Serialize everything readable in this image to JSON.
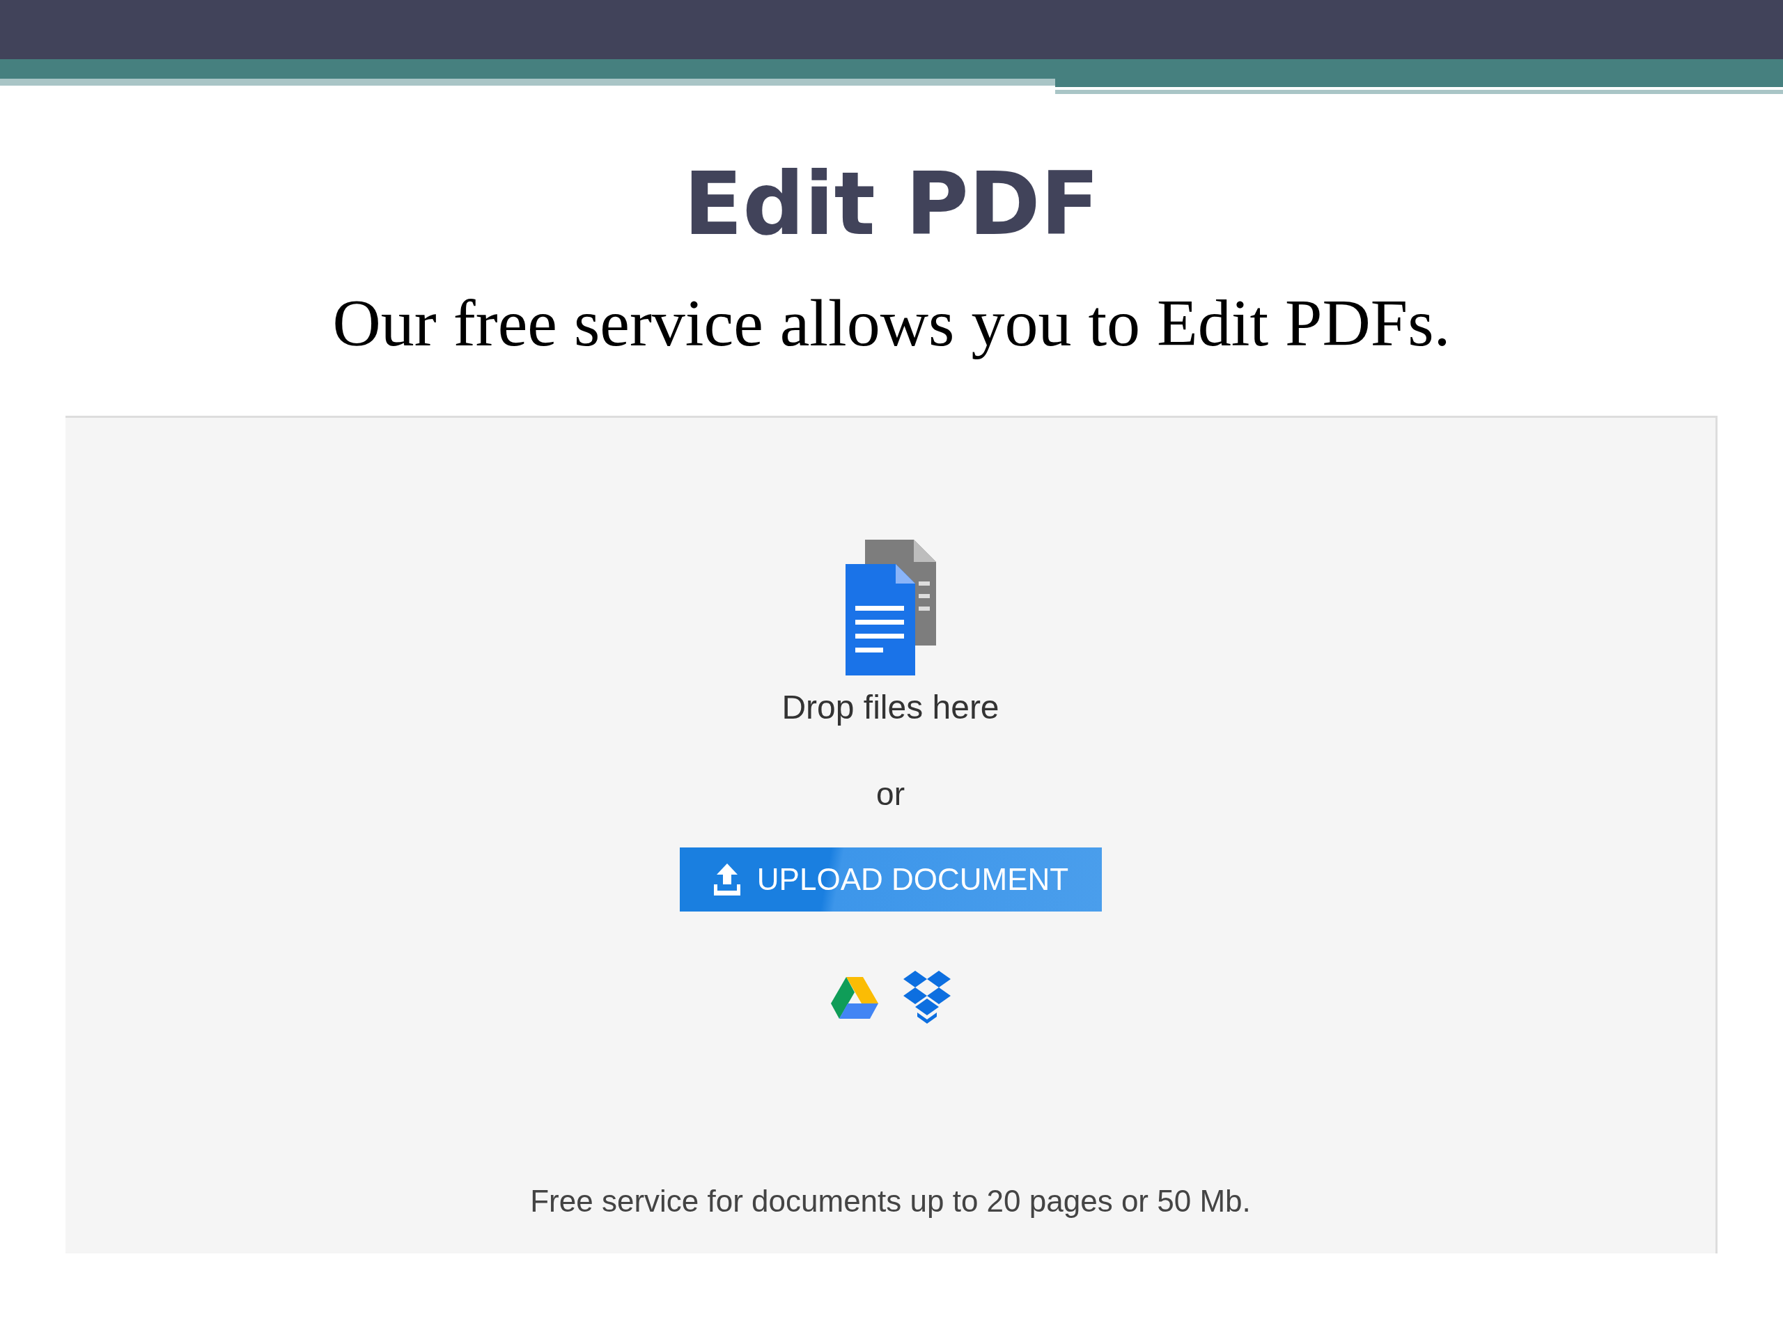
{
  "slide": {
    "title": "Edit PDF",
    "subtitle": "Our free service allows you to Edit PDFs."
  },
  "upload_panel": {
    "drop_text": "Drop files here",
    "separator": "or",
    "upload_button": "UPLOAD DOCUMENT",
    "note": "Free service for documents up to 20 pages or 50 Mb."
  }
}
